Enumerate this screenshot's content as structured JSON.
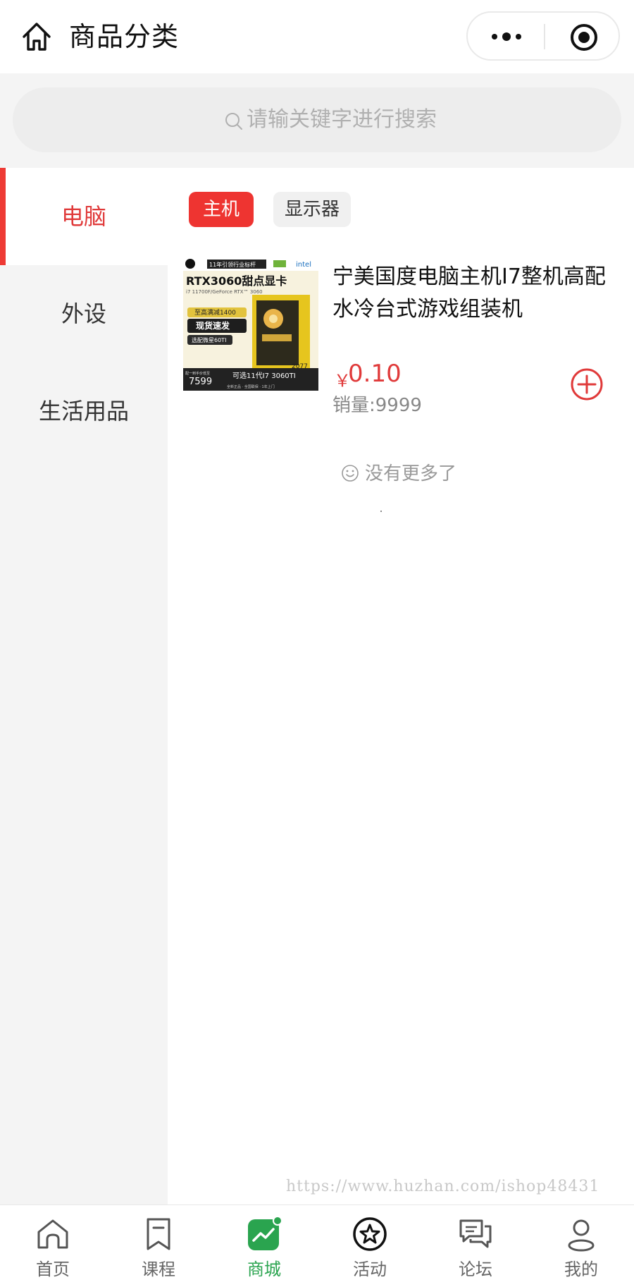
{
  "header": {
    "title": "商品分类",
    "home_icon": "home-icon",
    "more_icon": "more-icon",
    "target_icon": "target-icon"
  },
  "search": {
    "placeholder": "请输关键字进行搜索",
    "icon": "search-icon"
  },
  "sidebar": {
    "items": [
      {
        "label": "电脑",
        "active": true
      },
      {
        "label": "外设",
        "active": false
      },
      {
        "label": "生活用品",
        "active": false
      }
    ]
  },
  "subtabs": [
    {
      "label": "主机",
      "active": true
    },
    {
      "label": "显示器",
      "active": false
    }
  ],
  "product": {
    "title": "宁美国度电脑主机I7整机高配水冷台式游戏组装机",
    "currency": "￥",
    "price": "0.10",
    "sales": "销量:9999",
    "image": {
      "badge": "11年引领行业标杆",
      "brand": "intel",
      "headline": "RTX3060甜点显卡",
      "spec": "i7 11700F/GeForce RTX™ 3060",
      "promo1": "至高满减1400",
      "promo2": "现货速发",
      "promo3": "选配微星60TI",
      "price_label": "配一到手价低至",
      "price": "7599",
      "bottom": "可选11代I7 3060TI",
      "tags": "全新正品 · 全国联保 · 1年上门",
      "case_label": "2077"
    }
  },
  "list_end": "没有更多了",
  "watermark": "https://www.huzhan.com/ishop48431",
  "colors": {
    "accent": "#ee3431",
    "tab_active": "#2aa44f",
    "sidebar_bg": "#f4f4f4"
  },
  "tabbar": {
    "items": [
      {
        "label": "首页",
        "icon": "home-icon"
      },
      {
        "label": "课程",
        "icon": "bookmark-icon"
      },
      {
        "label": "商城",
        "icon": "chart-icon",
        "active": true
      },
      {
        "label": "活动",
        "icon": "star-icon"
      },
      {
        "label": "论坛",
        "icon": "chat-icon"
      },
      {
        "label": "我的",
        "icon": "user-icon"
      }
    ]
  }
}
